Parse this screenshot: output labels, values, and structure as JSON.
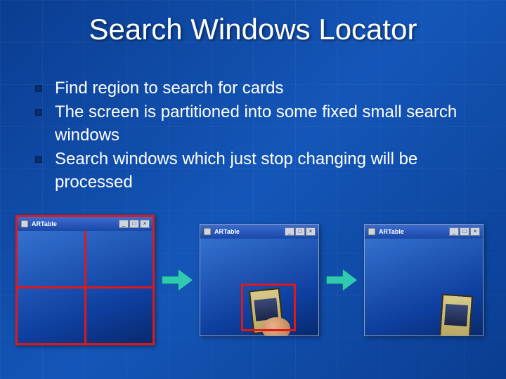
{
  "title": "Search Windows Locator",
  "bullets": [
    "Find region to search for cards",
    "The screen is partitioned into some fixed small search windows",
    "Search windows which just stop changing will be processed"
  ],
  "window_title": "ARTable",
  "window_controls": {
    "minimize": "_",
    "maximize": "□",
    "close": "×"
  }
}
